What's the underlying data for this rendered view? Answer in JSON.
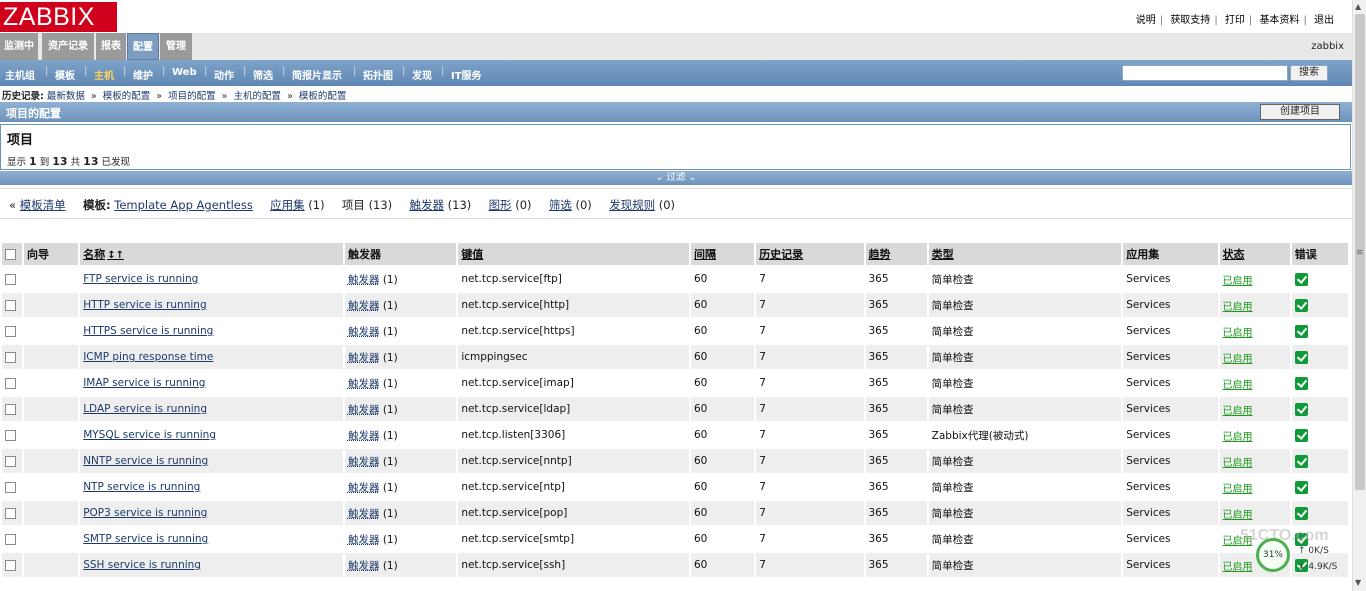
{
  "logo": "ZABBIX",
  "top_links": [
    "说明",
    "获取支持",
    "打印",
    "基本资料",
    "退出"
  ],
  "main_menu": [
    {
      "label": "监测中",
      "active": false
    },
    {
      "label": "资产记录",
      "active": false
    },
    {
      "label": "报表",
      "active": false
    },
    {
      "label": "配置",
      "active": true
    },
    {
      "label": "管理",
      "active": false
    }
  ],
  "user": "zabbix",
  "sub_menu": [
    {
      "label": "主机组",
      "active": false
    },
    {
      "label": "模板",
      "active": false
    },
    {
      "label": "主机",
      "active": true
    },
    {
      "label": "维护",
      "active": false
    },
    {
      "label": "Web",
      "active": false
    },
    {
      "label": "动作",
      "active": false
    },
    {
      "label": "筛选",
      "active": false
    },
    {
      "label": "简报片显示",
      "active": false
    },
    {
      "label": "拓扑图",
      "active": false
    },
    {
      "label": "发现",
      "active": false
    },
    {
      "label": "IT服务",
      "active": false
    }
  ],
  "search": {
    "value": "",
    "button": "搜索"
  },
  "history": {
    "label": "历史记录:",
    "items": [
      "最新数据",
      "模板的配置",
      "项目的配置",
      "主机的配置",
      "模板的配置"
    ],
    "sep": "»"
  },
  "page_header": {
    "title": "项目的配置",
    "create_button": "创建项目"
  },
  "panel": {
    "title": "项目",
    "showing": {
      "prefix": "显示",
      "from": "1",
      "to_word": "到",
      "to": "13",
      "of_word": "共",
      "total": "13",
      "suffix": "已发现"
    }
  },
  "filter_label": "⌄ 过滤 ⌄",
  "links": {
    "back_marker": "«",
    "template_list": "模板清单",
    "template_label": "模板:",
    "template_name": "Template App Agentless",
    "apps": "应用集",
    "apps_count": "(1)",
    "items": "项目",
    "items_count": "(13)",
    "triggers": "触发器",
    "triggers_count": "(13)",
    "graphs": "图形",
    "graphs_count": "(0)",
    "screens": "筛选",
    "screens_count": "(0)",
    "discovery": "发现规则",
    "discovery_count": "(0)"
  },
  "table": {
    "headers": {
      "wizard": "向导",
      "name": "名称",
      "triggers": "触发器",
      "key": "键值",
      "interval": "间隔",
      "history": "历史记录",
      "trends": "趋势",
      "type": "类型",
      "applications": "应用集",
      "status": "状态",
      "error": "错误"
    },
    "rows": [
      {
        "name": "FTP service is running",
        "trig": "触发器",
        "trig_count": "(1)",
        "key": "net.tcp.service[ftp]",
        "interval": "60",
        "history": "7",
        "trends": "365",
        "type": "简单检查",
        "apps": "Services",
        "status": "已启用"
      },
      {
        "name": "HTTP service is running",
        "trig": "触发器",
        "trig_count": "(1)",
        "key": "net.tcp.service[http]",
        "interval": "60",
        "history": "7",
        "trends": "365",
        "type": "简单检查",
        "apps": "Services",
        "status": "已启用"
      },
      {
        "name": "HTTPS service is running",
        "trig": "触发器",
        "trig_count": "(1)",
        "key": "net.tcp.service[https]",
        "interval": "60",
        "history": "7",
        "trends": "365",
        "type": "简单检查",
        "apps": "Services",
        "status": "已启用"
      },
      {
        "name": "ICMP ping response time",
        "trig": "触发器",
        "trig_count": "(1)",
        "key": "icmppingsec",
        "interval": "60",
        "history": "7",
        "trends": "365",
        "type": "简单检查",
        "apps": "Services",
        "status": "已启用"
      },
      {
        "name": "IMAP service is running",
        "trig": "触发器",
        "trig_count": "(1)",
        "key": "net.tcp.service[imap]",
        "interval": "60",
        "history": "7",
        "trends": "365",
        "type": "简单检查",
        "apps": "Services",
        "status": "已启用"
      },
      {
        "name": "LDAP service is running",
        "trig": "触发器",
        "trig_count": "(1)",
        "key": "net.tcp.service[ldap]",
        "interval": "60",
        "history": "7",
        "trends": "365",
        "type": "简单检查",
        "apps": "Services",
        "status": "已启用"
      },
      {
        "name": "MYSQL service is running",
        "trig": "触发器",
        "trig_count": "(1)",
        "key": "net.tcp.listen[3306]",
        "interval": "60",
        "history": "7",
        "trends": "365",
        "type": "Zabbix代理(被动式)",
        "apps": "Services",
        "status": "已启用"
      },
      {
        "name": "NNTP service is running",
        "trig": "触发器",
        "trig_count": "(1)",
        "key": "net.tcp.service[nntp]",
        "interval": "60",
        "history": "7",
        "trends": "365",
        "type": "简单检查",
        "apps": "Services",
        "status": "已启用"
      },
      {
        "name": "NTP service is running",
        "trig": "触发器",
        "trig_count": "(1)",
        "key": "net.tcp.service[ntp]",
        "interval": "60",
        "history": "7",
        "trends": "365",
        "type": "简单检查",
        "apps": "Services",
        "status": "已启用"
      },
      {
        "name": "POP3 service is running",
        "trig": "触发器",
        "trig_count": "(1)",
        "key": "net.tcp.service[pop]",
        "interval": "60",
        "history": "7",
        "trends": "365",
        "type": "简单检查",
        "apps": "Services",
        "status": "已启用"
      },
      {
        "name": "SMTP service is running",
        "trig": "触发器",
        "trig_count": "(1)",
        "key": "net.tcp.service[smtp]",
        "interval": "60",
        "history": "7",
        "trends": "365",
        "type": "简单检查",
        "apps": "Services",
        "status": "已启用"
      },
      {
        "name": "SSH service is running",
        "trig": "触发器",
        "trig_count": "(1)",
        "key": "net.tcp.service[ssh]",
        "interval": "60",
        "history": "7",
        "trends": "365",
        "type": "简单检查",
        "apps": "Services",
        "status": "已启用"
      }
    ]
  },
  "net_widget": {
    "percent": "31%",
    "up": "0K/S",
    "down": "4.9K/S"
  },
  "watermark": "51CTO.com",
  "colors": {
    "brand": "#d0021b",
    "menu_active": "#7c9cc0",
    "submenu": "#5f87b3",
    "status_enabled": "#1f9a1f",
    "ok_icon": "#0f9a3a"
  }
}
